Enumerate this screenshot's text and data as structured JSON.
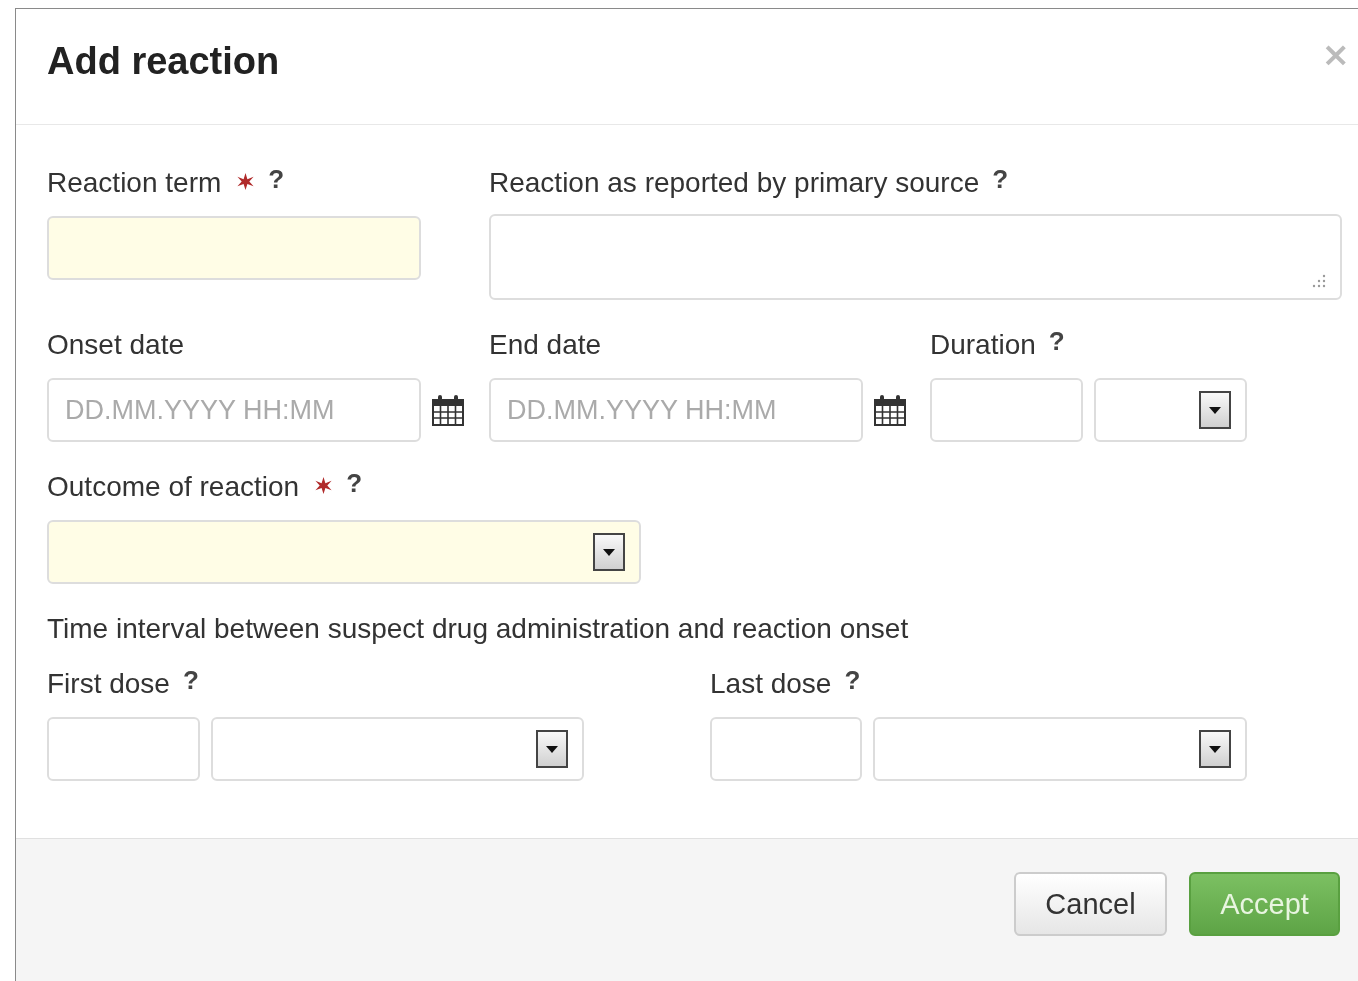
{
  "dialog": {
    "title": "Add reaction",
    "close": "×"
  },
  "sections": [
    {
      "kind": "fields",
      "groups": [
        {
          "label": "Reaction term",
          "required": true,
          "help": "?",
          "controls": [
            {
              "kind": "text",
              "required": true
            }
          ]
        },
        {
          "label": "Reaction as reported by primary source",
          "required": false,
          "help": "?",
          "controls": [
            {
              "kind": "textarea",
              "required": false
            }
          ]
        }
      ]
    },
    {
      "kind": "fields",
      "groups": [
        {
          "label": "Onset date",
          "required": false,
          "controls": [
            {
              "kind": "date",
              "required": false,
              "placeholder": "DD.MM.YYYY HH:MM"
            }
          ]
        },
        {
          "label": "End date",
          "required": false,
          "controls": [
            {
              "kind": "date",
              "required": false,
              "placeholder": "DD.MM.YYYY HH:MM"
            }
          ]
        },
        {
          "label": "Duration",
          "required": false,
          "help": "?",
          "controls": [
            {
              "kind": "text",
              "required": false
            },
            {
              "kind": "select",
              "required": false
            }
          ]
        }
      ]
    },
    {
      "kind": "fields",
      "groups": [
        {
          "label": "Outcome of reaction",
          "required": true,
          "help": "?",
          "controls": [
            {
              "kind": "select",
              "required": true
            }
          ]
        }
      ]
    },
    {
      "kind": "note",
      "text": "Time interval between suspect drug administration and reaction onset"
    },
    {
      "kind": "fields",
      "groups": [
        {
          "label": "First dose",
          "required": false,
          "help": "?",
          "controls": [
            {
              "kind": "text",
              "required": false
            },
            {
              "kind": "select",
              "required": false
            }
          ]
        },
        {
          "label": "Last dose",
          "required": false,
          "help": "?",
          "controls": [
            {
              "kind": "text",
              "required": false
            },
            {
              "kind": "select",
              "required": false
            }
          ]
        }
      ]
    }
  ],
  "buttons": [
    {
      "label": "Cancel",
      "kind": "default"
    },
    {
      "label": "Accept",
      "kind": "primary"
    }
  ]
}
